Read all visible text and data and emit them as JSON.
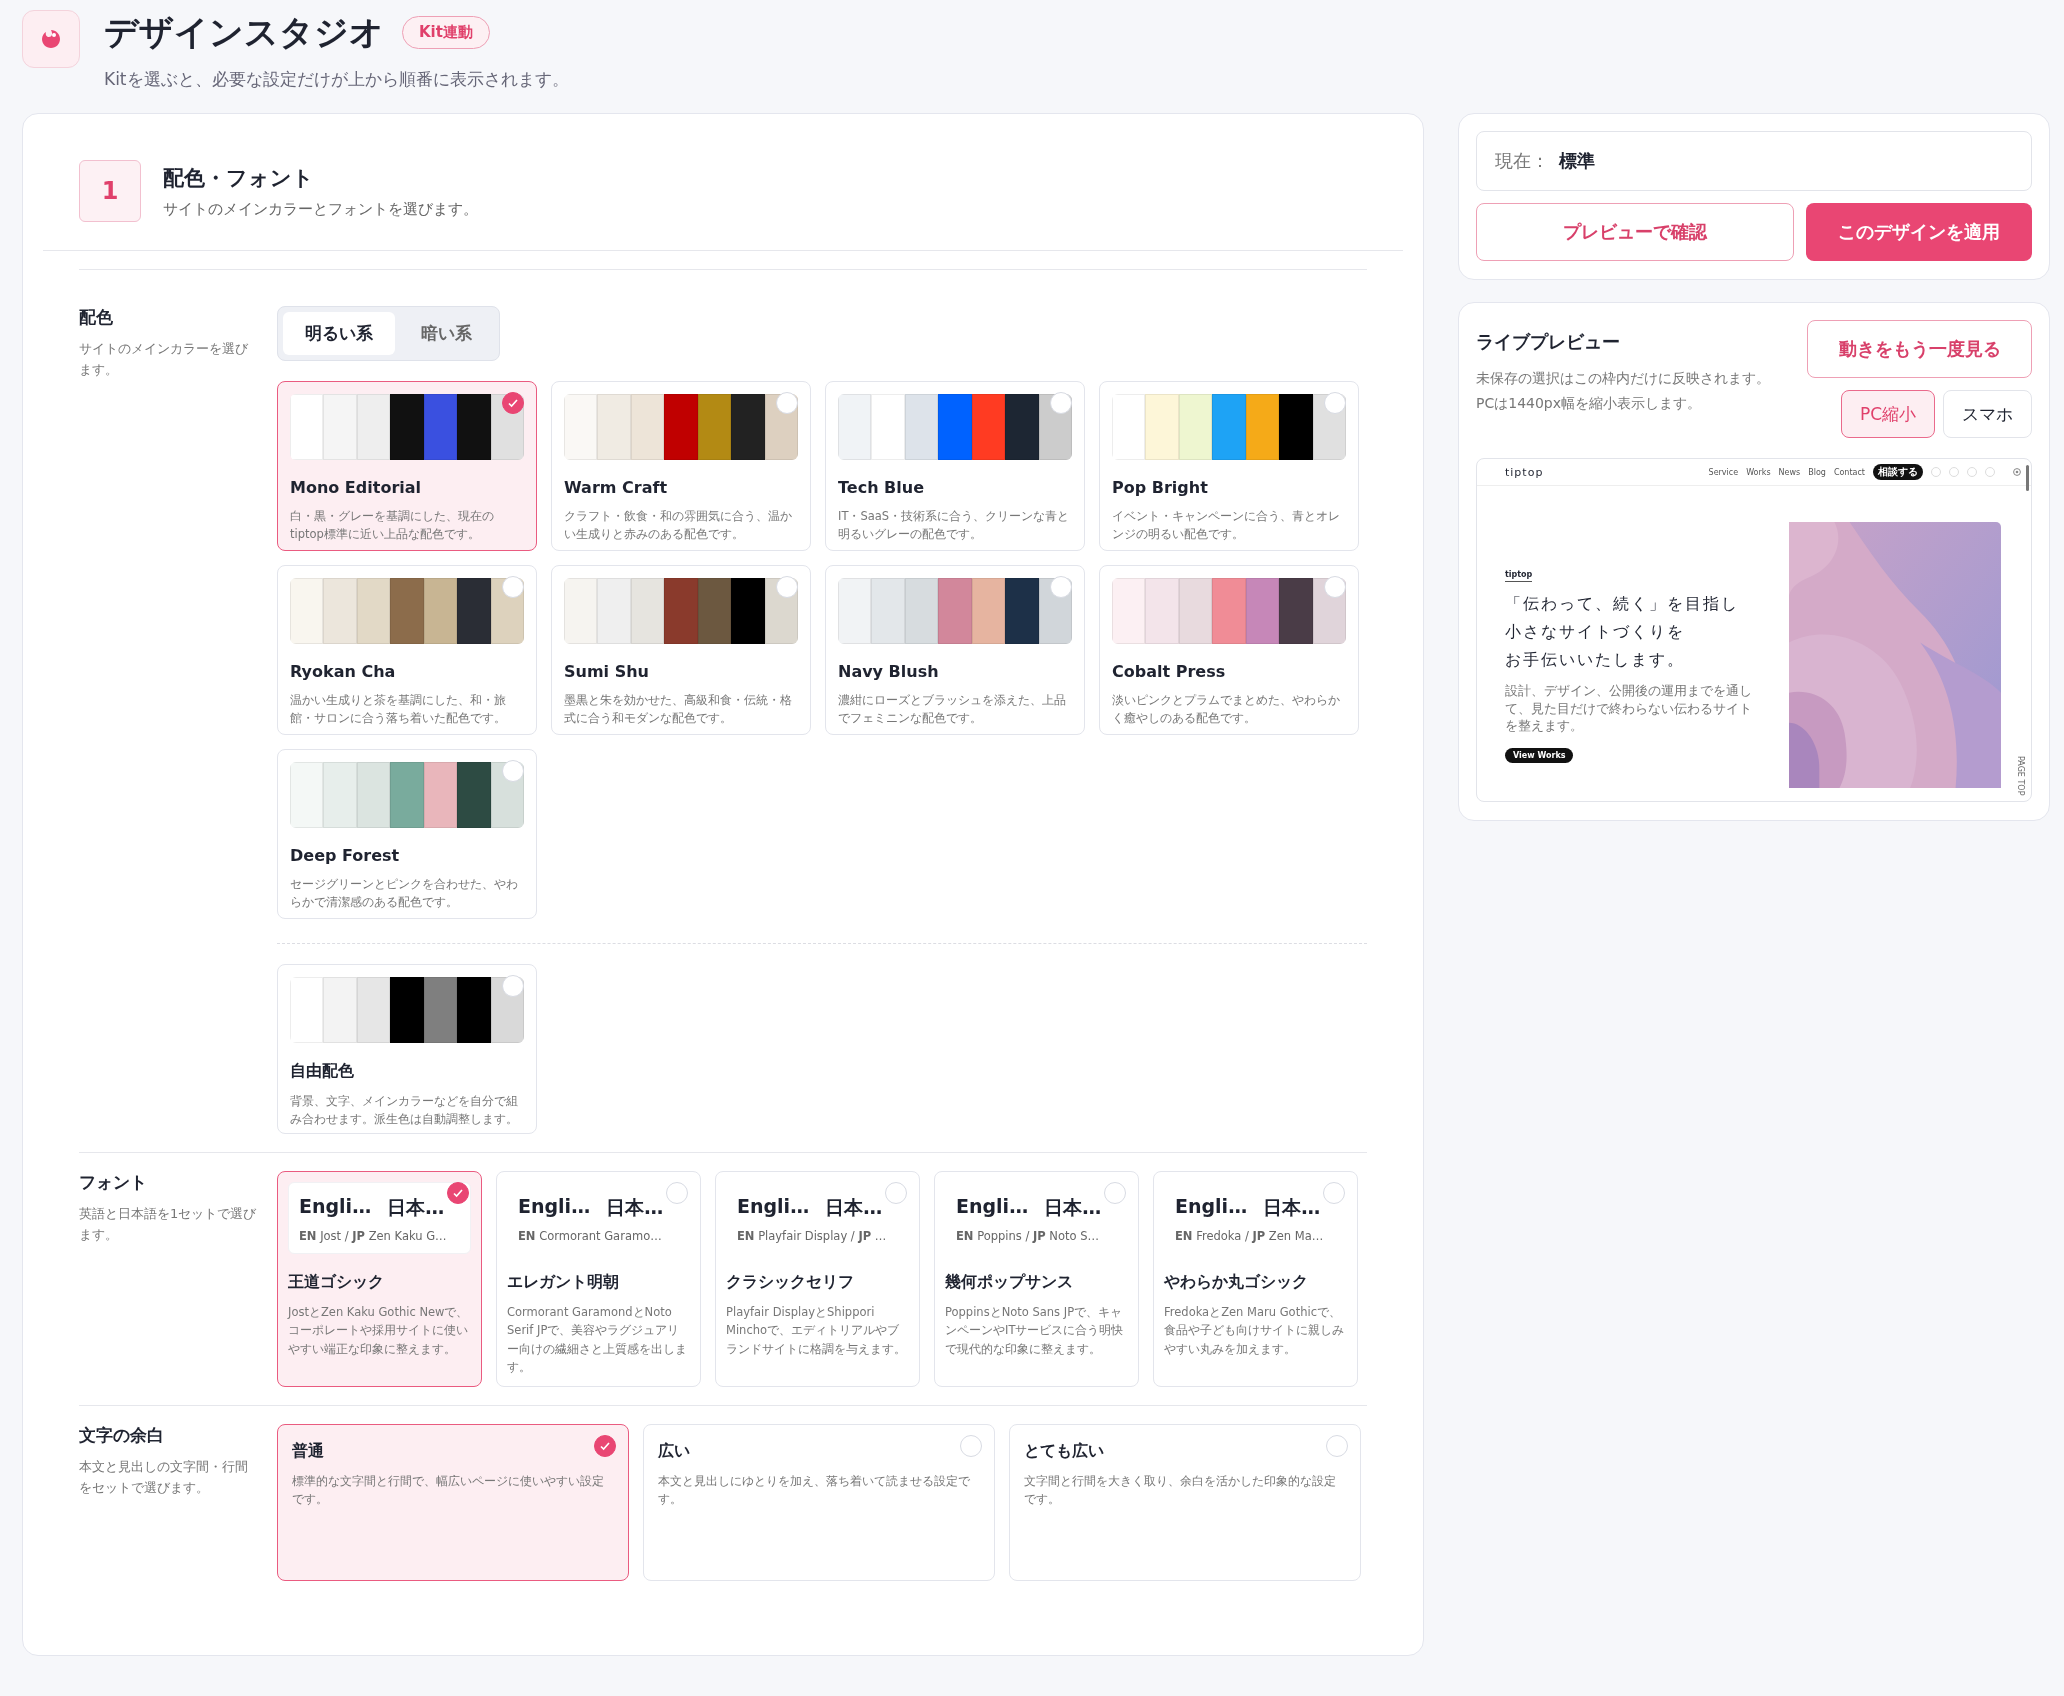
{
  "header": {
    "title": "デザインスタジオ",
    "badge": "Kit連動",
    "subtitle": "Kitを選ぶと、必要な設定だけが上から順番に表示されます。"
  },
  "step": {
    "number": "1",
    "title": "配色・フォント",
    "description": "サイトのメインカラーとフォントを選びます。"
  },
  "palette": {
    "label": "配色",
    "description": "サイトのメインカラーを選びます。",
    "tabs": [
      {
        "label": "明るい系",
        "selected": true
      },
      {
        "label": "暗い系",
        "selected": false
      }
    ],
    "options": [
      {
        "name": "Mono Editorial",
        "description": "白・黒・グレーを基調にした、現在のtiptop標準に近い上品な配色です。",
        "selected": true,
        "swatches": [
          {
            "color": "#ffffff"
          },
          {
            "color": "#f5f5f5"
          },
          {
            "color": "#eeeeee"
          },
          {
            "color": "#111111"
          },
          {
            "color": "#3a50e0"
          },
          {
            "color": "#111111"
          },
          {
            "color": "#e0e0e0"
          }
        ]
      },
      {
        "name": "Warm Craft",
        "description": "クラフト・飲食・和の雰囲気に合う、温かい生成りと赤みのある配色です。",
        "selected": false,
        "swatches": [
          {
            "color": "#faf8f5"
          },
          {
            "color": "#f0ebe3"
          },
          {
            "color": "#ede4d8"
          },
          {
            "color": "#c00000"
          },
          {
            "color": "#b38a14"
          },
          {
            "color": "#222222"
          },
          {
            "color": "#ddd0c0"
          }
        ]
      },
      {
        "name": "Tech Blue",
        "description": "IT・SaaS・技術系に合う、クリーンな青と明るいグレーの配色です。",
        "selected": false,
        "swatches": [
          {
            "color": "#f0f3f6"
          },
          {
            "color": "#ffffff"
          },
          {
            "color": "#dde3ea"
          },
          {
            "color": "#0062ff"
          },
          {
            "color": "#ff3b22"
          },
          {
            "color": "#1d2633"
          },
          {
            "color": "#cccccc"
          }
        ]
      },
      {
        "name": "Pop Bright",
        "description": "イベント・キャンペーンに合う、青とオレンジの明るい配色です。",
        "selected": false,
        "swatches": [
          {
            "color": "#ffffff"
          },
          {
            "color": "#fdf6d8"
          },
          {
            "color": "#eef6d0"
          },
          {
            "color": "#1ea3f5"
          },
          {
            "color": "#f5aa18"
          },
          {
            "color": "#000000"
          },
          {
            "color": "#e0e0e0"
          }
        ]
      },
      {
        "name": "Ryokan Cha",
        "description": "温かい生成りと茶を基調にした、和・旅館・サロンに合う落ち着いた配色です。",
        "selected": false,
        "swatches": [
          {
            "color": "#f9f6ef"
          },
          {
            "color": "#ece6dc"
          },
          {
            "color": "#e2d9c6"
          },
          {
            "color": "#8c6c4b"
          },
          {
            "color": "#c8b593"
          },
          {
            "color": "#2a2d35"
          },
          {
            "color": "#ddd2bd"
          }
        ]
      },
      {
        "name": "Sumi Shu",
        "description": "墨黒と朱を効かせた、高級和食・伝統・格式に合う和モダンな配色です。",
        "selected": false,
        "swatches": [
          {
            "color": "#f6f4f0"
          },
          {
            "color": "#efefef"
          },
          {
            "color": "#e6e4df"
          },
          {
            "color": "#8a3a2c"
          },
          {
            "color": "#6c5840"
          },
          {
            "color": "#000000"
          },
          {
            "color": "#dcd8cf"
          }
        ]
      },
      {
        "name": "Navy Blush",
        "description": "濃紺にローズとブラッシュを添えた、上品でフェミニンな配色です。",
        "selected": false,
        "swatches": [
          {
            "color": "#f1f3f5"
          },
          {
            "color": "#e3e7ea"
          },
          {
            "color": "#d7dcdf"
          },
          {
            "color": "#d2879b"
          },
          {
            "color": "#e6b4a0"
          },
          {
            "color": "#1d3048"
          },
          {
            "color": "#d1d6da"
          }
        ]
      },
      {
        "name": "Cobalt Press",
        "description": "淡いピンクとプラムでまとめた、やわらかく癒やしのある配色です。",
        "selected": false,
        "swatches": [
          {
            "color": "#fcf0f3"
          },
          {
            "color": "#f3e4ea"
          },
          {
            "color": "#e8dade"
          },
          {
            "color": "#f08c96"
          },
          {
            "color": "#c687b8"
          },
          {
            "color": "#4a3c47"
          },
          {
            "color": "#e0d4da"
          }
        ]
      },
      {
        "name": "Deep Forest",
        "description": "セージグリーンとピンクを合わせた、やわらかで清潔感のある配色です。",
        "selected": false,
        "swatches": [
          {
            "color": "#f4f8f6"
          },
          {
            "color": "#e7eeeb"
          },
          {
            "color": "#dbe4e0"
          },
          {
            "color": "#79ab9d"
          },
          {
            "color": "#e9b6bb"
          },
          {
            "color": "#2d4b43"
          },
          {
            "color": "#d7e0dc"
          }
        ]
      }
    ],
    "custom": {
      "name": "自由配色",
      "description": "背景、文字、メインカラーなどを自分で組み合わせます。派生色は自動調整します。",
      "selected": false,
      "swatches": [
        {
          "color": "#ffffff"
        },
        {
          "color": "#f3f3f3"
        },
        {
          "color": "#e6e6e6"
        },
        {
          "color": "#000000"
        },
        {
          "color": "#7f7f7f"
        },
        {
          "color": "#000000"
        },
        {
          "color": "#d9d9d9"
        }
      ]
    }
  },
  "fonts": {
    "label": "フォント",
    "description": "英語と日本語を1セットで選びます。",
    "options": [
      {
        "sample_en": "Engli…",
        "sample_ja": "日本…",
        "spec": "**EN** Jost / **JP** Zen Kaku G…",
        "name": "王道ゴシック",
        "description": "JostとZen Kaku Gothic Newで、コーポレートや採用サイトに使いやすい端正な印象に整えます。",
        "selected": true
      },
      {
        "sample_en": "Engli…",
        "sample_ja": "日本…",
        "spec": "**EN** Cormorant Garamo…",
        "name": "エレガント明朝",
        "description": "Cormorant GaramondとNoto Serif JPで、美容やラグジュアリー向けの繊細さと上質感を出します。",
        "selected": false
      },
      {
        "sample_en": "Engli…",
        "sample_ja": "日本…",
        "spec": "**EN** Playfair Display / **JP** …",
        "name": "クラシックセリフ",
        "description": "Playfair DisplayとShippori Minchoで、エディトリアルやブランドサイトに格調を与えます。",
        "selected": false
      },
      {
        "sample_en": "Engli…",
        "sample_ja": "日本…",
        "spec": "**EN** Poppins / **JP** Noto S…",
        "name": "幾何ポップサンス",
        "description": "PoppinsとNoto Sans JPで、キャンペーンやITサービスに合う明快で現代的な印象に整えます。",
        "selected": false
      },
      {
        "sample_en": "Engli…",
        "sample_ja": "日本…",
        "spec": "**EN** Fredoka / **JP** Zen Ma…",
        "name": "やわらか丸ゴシック",
        "description": "FredokaとZen Maru Gothicで、食品や子ども向けサイトに親しみやすい丸みを加えます。",
        "selected": false
      }
    ]
  },
  "spacing": {
    "label": "文字の余白",
    "description": "本文と見出しの文字間・行間をセットで選びます。",
    "options": [
      {
        "name": "普通",
        "description": "標準的な文字間と行間で、幅広いページに使いやすい設定です。",
        "selected": true
      },
      {
        "name": "広い",
        "description": "本文と見出しにゆとりを加え、落ち着いて読ませる設定です。",
        "selected": false
      },
      {
        "name": "とても広い",
        "description": "文字間と行間を大きく取り、余白を活かした印象的な設定です。",
        "selected": false
      }
    ]
  },
  "actions": {
    "current_label": "現在：",
    "current_value": "標準",
    "preview_button": "プレビューで確認",
    "apply_button": "このデザインを適用"
  },
  "live_preview": {
    "title": "ライブプレビュー",
    "description": "未保存の選択はこの枠内だけに反映されます。PCは1440px幅を縮小表示します。",
    "replay_button": "動きをもう一度見る",
    "views": [
      {
        "label": "PC縮小",
        "selected": true
      },
      {
        "label": "スマホ",
        "selected": false
      }
    ],
    "site": {
      "logo": "tiptop",
      "nav": [
        "Service",
        "Works",
        "News",
        "Blog",
        "Contact"
      ],
      "cta": "相談する",
      "eyebrow": "tiptop",
      "headline": [
        "「伝わって、続く」を目指し",
        "小さなサイトづくりを",
        "お手伝いいたします。"
      ],
      "body": "設計、デザイン、公開後の運用までを通して、見た目だけで終わらない伝わるサイトを整えます。",
      "button": "View Works",
      "page_top": "PAGE TOP"
    }
  }
}
